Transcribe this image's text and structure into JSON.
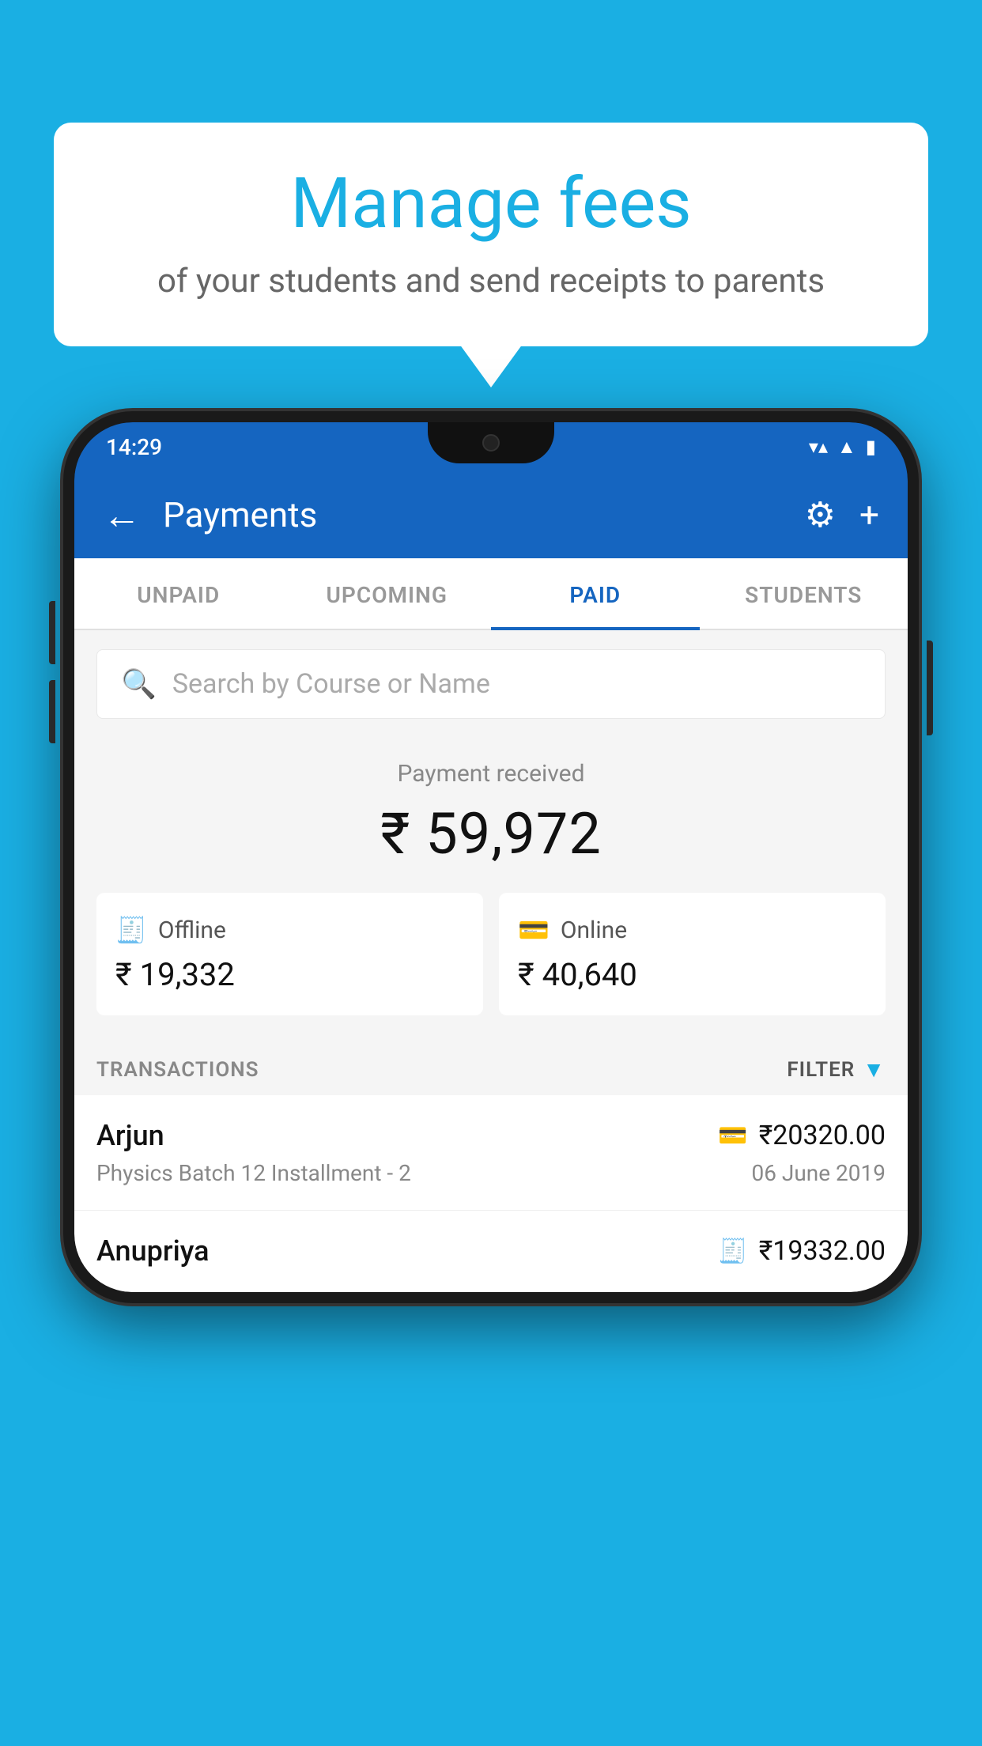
{
  "background_color": "#1AAFE3",
  "bubble": {
    "title": "Manage fees",
    "subtitle": "of your students and send receipts to parents"
  },
  "status_bar": {
    "time": "14:29",
    "icons": [
      "wifi",
      "signal",
      "battery"
    ]
  },
  "app_bar": {
    "title": "Payments",
    "back_label": "←",
    "settings_icon": "⚙",
    "add_icon": "+"
  },
  "tabs": [
    {
      "label": "UNPAID",
      "active": false
    },
    {
      "label": "UPCOMING",
      "active": false
    },
    {
      "label": "PAID",
      "active": true
    },
    {
      "label": "STUDENTS",
      "active": false
    }
  ],
  "search": {
    "placeholder": "Search by Course or Name"
  },
  "payment_summary": {
    "label": "Payment received",
    "total": "₹ 59,972",
    "offline_label": "Offline",
    "offline_amount": "₹ 19,332",
    "online_label": "Online",
    "online_amount": "₹ 40,640"
  },
  "transactions": {
    "header_label": "TRANSACTIONS",
    "filter_label": "FILTER",
    "rows": [
      {
        "name": "Arjun",
        "course": "Physics Batch 12 Installment - 2",
        "amount": "₹20320.00",
        "date": "06 June 2019",
        "payment_type": "online"
      },
      {
        "name": "Anupriya",
        "course": "",
        "amount": "₹19332.00",
        "date": "",
        "payment_type": "offline"
      }
    ]
  }
}
